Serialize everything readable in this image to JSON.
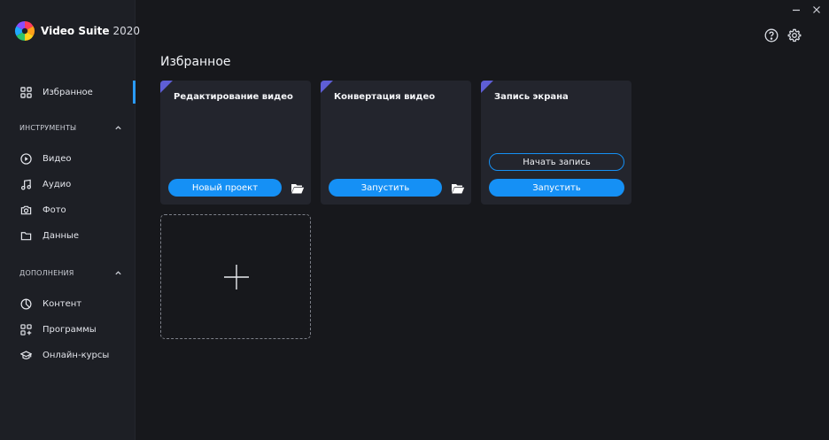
{
  "app": {
    "name": "Video Suite",
    "year": "2020"
  },
  "nav": {
    "favorites": "Избранное",
    "tools_header": "ИНСТРУМЕНТЫ",
    "tools": [
      {
        "label": "Видео",
        "icon": "play-icon"
      },
      {
        "label": "Аудио",
        "icon": "music-note-icon"
      },
      {
        "label": "Фото",
        "icon": "camera-icon"
      },
      {
        "label": "Данные",
        "icon": "folder-icon"
      }
    ],
    "addons_header": "ДОПОЛНЕНИЯ",
    "addons": [
      {
        "label": "Контент",
        "icon": "pie-chart-icon"
      },
      {
        "label": "Программы",
        "icon": "apps-plus-icon"
      },
      {
        "label": "Онлайн-курсы",
        "icon": "graduation-cap-icon"
      }
    ]
  },
  "main": {
    "title": "Избранное",
    "cards": [
      {
        "title": "Редактирование видео",
        "primary": "Новый проект"
      },
      {
        "title": "Конвертация видео",
        "primary": "Запустить"
      },
      {
        "title": "Запись экрана",
        "secondary": "Начать запись",
        "primary": "Запустить"
      }
    ]
  },
  "colors": {
    "accent": "#1590f5",
    "corner": "#5e5ed6",
    "background": "#17181c",
    "sidebar": "#1d1f25",
    "card": "#23252d"
  }
}
